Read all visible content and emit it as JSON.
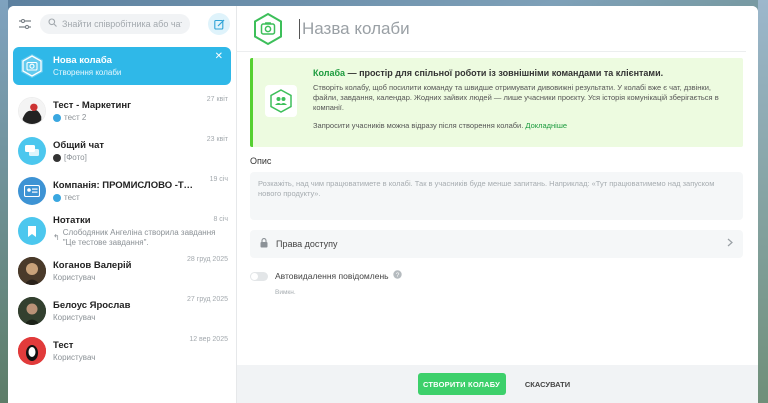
{
  "sidebar": {
    "search_placeholder": "Знайти співробітника або чат",
    "chats": [
      {
        "title": "Нова колаба",
        "subtitle": "Створення колаби",
        "time": "",
        "active": true
      },
      {
        "title": "Тест - Маркетинг",
        "subtitle": "тест 2",
        "time": "27 квіт"
      },
      {
        "title": "Общий чат",
        "subtitle": "[Фото]",
        "time": "23 квіт"
      },
      {
        "title": "Компанія: ПРОМИСЛОВО -ТОРГОВЕ...",
        "subtitle": "тест",
        "time": "19 січ"
      },
      {
        "title": "Нотатки",
        "subtitle": "Слободяник Ангеліна створила завдання \"Це тестове завдання\".",
        "time": "8 січ"
      },
      {
        "title": "Коганов Валерій",
        "subtitle": "Користувач",
        "time": "28 груд 2025"
      },
      {
        "title": "Белоус Ярослав",
        "subtitle": "Користувач",
        "time": "27 груд 2025"
      },
      {
        "title": "Тест",
        "subtitle": "Користувач",
        "time": "12 вер 2025"
      }
    ]
  },
  "main": {
    "title_placeholder": "Назва колаби",
    "info": {
      "brand": "Колаба",
      "headline_rest": " — простір для спільної роботи із зовнішніми командами та клієнтами.",
      "description": "Створіть колабу, щоб посилити команду та швидше отримувати дивовижні результати. У колабі вже є чат, дзвінки, файли, завдання, календар. Жодних зайвих людей — лише учасники проєкту. Уся історія комунікацій зберігається в компанії.",
      "invite_text": "Запросити учасників можна відразу після створення колаби. ",
      "invite_link": "Докладніше"
    },
    "description_label": "Опис",
    "description_placeholder": "Розкажіть, над чим працюватимете в колабі. Так в учасників буде менше запитань. Наприклад: «Тут працюватимемо над запуском нового продукту».",
    "access_label": "Права доступу",
    "autodelete_label": "Автовидалення повідомлень",
    "autodelete_state": "Вимкн."
  },
  "footer": {
    "create_label": "СТВОРИТИ КОЛАБУ",
    "cancel_label": "СКАСУВАТИ"
  },
  "colors": {
    "accent": "#2fb8e8",
    "green": "#3dd06b",
    "brand_green": "#1c9b3e",
    "info_bg": "#edfbe0"
  }
}
